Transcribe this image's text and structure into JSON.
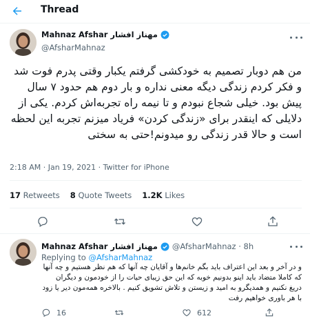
{
  "header": {
    "title": "Thread",
    "back_icon": "arrow-left-icon",
    "accent": "#1d9bf0"
  },
  "tweet": {
    "display_name": "Mahnaz Afshar مهناز افشار",
    "handle": "@AfsharMahnaz",
    "text": "من هم دوبار تصمیم به خودکشی گرفتم یکبار وقتی پدرم فوت شد و فکر کردم زندگی دیگه معنی نداره و بار دوم هم حدود ۷ سال پیش بود. خیلی شجاع نبودم و تا نیمه راه تجربه‌اش کردم. یکی از دلایلی که اینقدر برای «زندگی کردن» فریاد میزنم تجربه این لحظه است و حالا قدر زندگی رو میدونم!حتی به سختی",
    "timestamp": "2:18 AM · Jan 19, 2021 · Twitter for iPhone",
    "stats": {
      "retweets_count": "17",
      "retweets_label": "Retweets",
      "quotes_count": "8",
      "quotes_label": "Quote Tweets",
      "likes_count": "1.2K",
      "likes_label": "Likes"
    }
  },
  "reply": {
    "display_name": "Mahnaz Afshar مهناز افشار",
    "handle_time": "@AfsharMahnaz · 8h",
    "replying_prefix": "Replying to",
    "replying_to": "@AfsharMahnaz",
    "text": "و در آخر و بعد این اعتراف باید بگم خانم‌ها و آقایان چه آنها که هم نظر هستیم و چه آنها که کاملا متضاد باید اینو بدونیم خوبه که این حق زیبای حیات را از خودمون و دیگران دریغ نکنیم و همدیگرو به امید و زیستن و تلاش تشویق کنیم . بالاخره همه‌مون دیر یا زود با هر باوری خواهیم رفت",
    "counts": {
      "replies": "16",
      "retweets": "",
      "likes": "612"
    }
  }
}
